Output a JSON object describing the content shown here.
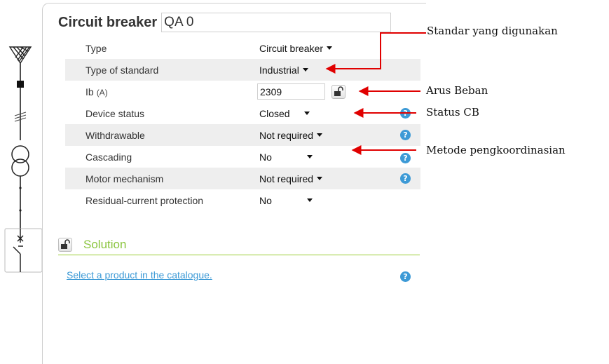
{
  "panel": {
    "title_label": "Circuit breaker",
    "title_value": "QA 0"
  },
  "rows": [
    {
      "label": "Type",
      "value": "Circuit breaker"
    },
    {
      "label": "Type of standard",
      "value": "Industrial"
    },
    {
      "label": "Ib",
      "unit": "(A)",
      "value": "2309"
    },
    {
      "label": "Device status",
      "value": "Closed"
    },
    {
      "label": "Withdrawable",
      "value": "Not required"
    },
    {
      "label": "Cascading",
      "value": "No"
    },
    {
      "label": "Motor mechanism",
      "value": "Not required"
    },
    {
      "label": "Residual-current protection",
      "value": "No"
    }
  ],
  "help_glyph": "?",
  "solution": {
    "title": "Solution",
    "link": "Select a product in the catalogue."
  },
  "annotations": {
    "standard": "Standar yang digunakan",
    "load_current": "Arus Beban",
    "status": "Status CB",
    "coordination": "Metode pengkoordinasian"
  },
  "colors": {
    "accent_green": "#8bc53f",
    "link_blue": "#3d9ad6",
    "help_blue": "#3d9ad6",
    "arrow_red": "#e00000"
  },
  "icons": [
    "grid-source-icon",
    "transformer-icon",
    "circuit-breaker-icon",
    "lock-icon",
    "help-icon",
    "dropdown-caret-icon"
  ]
}
